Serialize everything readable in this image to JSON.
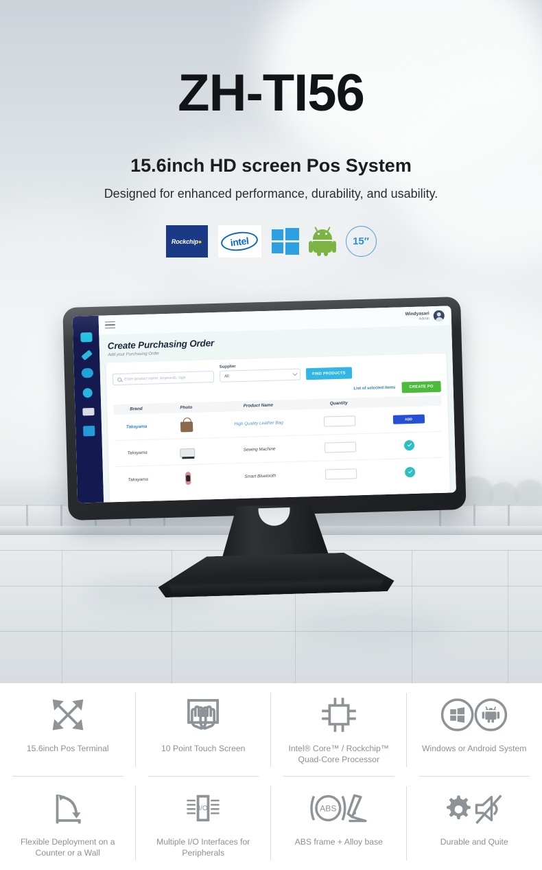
{
  "hero": {
    "model": "ZH-TI56",
    "tagline": "15.6inch HD screen Pos System",
    "subtagline": "Designed for enhanced performance, durability, and usability."
  },
  "badges": {
    "rockchip_label": "Rockchip",
    "intel_label": "intel",
    "windows_name": "windows-logo-icon",
    "android_name": "android-logo-icon",
    "size_label": "15″"
  },
  "pos_screen": {
    "menu_icon": "hamburger-menu-icon",
    "user": {
      "name": "Windyasari",
      "role": "Admin"
    },
    "page_title": "Create Purchasing Order",
    "page_subtitle": "Add your Purchasing Order",
    "search": {
      "placeholder": "Enter product name, keywords, tags"
    },
    "supplier": {
      "label": "Supplier",
      "value": "All"
    },
    "find_button": "FIND PRODUCTS",
    "selected_items_label": "List of selected items",
    "create_po_button": "CREATE PO",
    "table": {
      "headers": [
        "Brand",
        "Photo",
        "Product Name",
        "Quantity",
        ""
      ],
      "rows": [
        {
          "brand": "Takayama",
          "photo": "leather-bag-photo",
          "name": "High Quality Leather Bag",
          "qty": "",
          "action": "ADD"
        },
        {
          "brand": "Takayama",
          "photo": "sewing-machine-photo",
          "name": "Sewing Machine",
          "qty": "",
          "action": "check"
        },
        {
          "brand": "Takayama",
          "photo": "smart-bluetooth-photo",
          "name": "Smart Bluetooth",
          "qty": "",
          "action": "check"
        }
      ]
    }
  },
  "features": [
    {
      "icon": "diagonal-arrows-icon",
      "label": "15.6inch Pos Terminal"
    },
    {
      "icon": "ten-finger-touch-icon",
      "label": "10 Point Touch Screen"
    },
    {
      "icon": "cpu-chip-icon",
      "label": "Intel® Core™ / Rockchip™ Quad-Core Processor"
    },
    {
      "icon": "windows-android-circles-icon",
      "label": "Windows or Android System"
    },
    {
      "icon": "flexible-mount-icon",
      "label": "Flexible Deployment on a Counter or a Wall"
    },
    {
      "icon": "io-ports-icon",
      "label": "Multiple I/O Interfaces for Peripherals"
    },
    {
      "icon": "abs-frame-icon",
      "label": "ABS frame + Alloy base"
    },
    {
      "icon": "gear-mute-icon",
      "label": "Durable and Quite"
    }
  ],
  "colors": {
    "rockchip_blue": "#1b3a85",
    "intel_blue": "#0a69c8",
    "windows_blue": "#2ca0e0",
    "android_green": "#7cb342",
    "size_badge_blue": "#2b8fd4",
    "sidebar_navy": "#141a4f",
    "find_button_blue": "#32b6e5",
    "create_po_green": "#4cbb3c",
    "add_button_blue": "#2450d8",
    "check_teal": "#2cbfc4",
    "feature_gray": "#8e9397"
  }
}
